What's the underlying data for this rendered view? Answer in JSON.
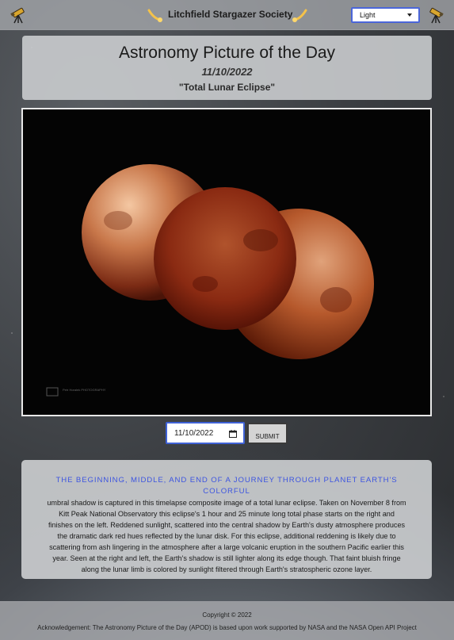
{
  "header": {
    "site_title": "Litchfield Stargazer Society",
    "theme_select": {
      "value": "Light"
    }
  },
  "apod": {
    "heading": "Astronomy Picture of the Day",
    "date": "11/10/2022",
    "title": "\"Total Lunar Eclipse\"",
    "photo_credit_watermark": "Petr Horalek PHOTOGRAPHY"
  },
  "controls": {
    "date_value": "11/10/2022",
    "submit_label": "SUBMIT"
  },
  "description": {
    "heading": "THE BEGINNING, MIDDLE, AND END OF A JOURNEY THROUGH PLANET EARTH'S COLORFUL",
    "lines": [
      "umbral shadow is captured in this timelapse composite image of a total lunar eclipse. Taken on November 8 from",
      "Kitt Peak National Observatory this eclipse's 1 hour and 25 minute long total phase starts on the right and",
      "finishes on the left. Reddened sunlight, scattered into the central shadow by Earth's dusty atmosphere produces",
      "the dramatic dark red hues reflected by the lunar disk. For this eclipse, additional reddening is likely due to",
      "scattering from ash lingering in the atmosphere after a large volcanic eruption in the southern Pacific earlier this",
      "year. Seen at the right and left, the Earth's shadow is still lighter along its edge though. That faint bluish fringe",
      "along the lunar limb is colored by sunlight filtered through Earth's stratospheric ozone layer."
    ]
  },
  "footer": {
    "copyright": "Copyright © 2022",
    "acknowledgement": "Acknowledgement: The Astronomy Picture of the Day (APOD) is based upon work supported by NASA and the NASA Open API Project"
  },
  "icons": [
    "telescope-icon",
    "comet-icon",
    "chevron-down-icon",
    "calendar-icon"
  ],
  "colors": {
    "accent": "#3d55e0",
    "input_border": "#3f62d6"
  }
}
